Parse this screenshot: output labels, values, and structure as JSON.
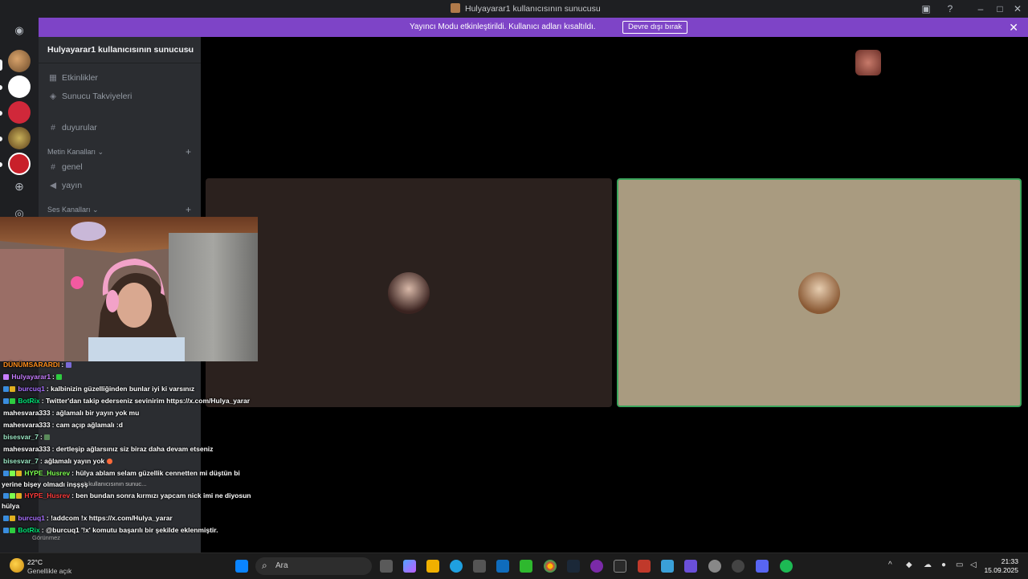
{
  "window": {
    "title": "Hulyayarar1 kullanıcısının sunucusu"
  },
  "banner": {
    "message": "Yayıncı Modu etkinleştirildi. Kullanıcı adları kısaltıldı.",
    "disable_button": "Devre dışı bırak"
  },
  "sidebar": {
    "server_name": "Hulyayarar1 kullanıcısının sunucusu",
    "items": [
      {
        "label": "Etkinlikler",
        "icon": "calendar-icon"
      },
      {
        "label": "Sunucu Takviyeleri",
        "icon": "boost-icon"
      },
      {
        "label": "duyurular",
        "icon": "hash-icon"
      }
    ],
    "text_category": "Metin Kanalları",
    "text_channels": [
      {
        "label": "genel",
        "icon": "hash-icon"
      },
      {
        "label": "yayın",
        "icon": "megaphone-icon"
      }
    ],
    "voice_category": "Ses Kanalları",
    "voice_hint": "1 kullanıcısının sunuc...",
    "status_hint": "Görünmez"
  },
  "chat": [
    {
      "user": "DÜNÜMSARARDI",
      "text": ":",
      "color": "#ff8c1a"
    },
    {
      "user": "Hulyayarar1",
      "text": ":",
      "color": "#c77dff"
    },
    {
      "user": "burcuq1",
      "text": ": kalbinizin güzelliğinden bunlar iyi ki varsınız",
      "color": "#a970ff"
    },
    {
      "user": "BotRix",
      "text": ": Twitter'dan takip ederseniz sevinirim https://x.com/Hulya_yarar",
      "color": "#00e676"
    },
    {
      "user": "mahesvara333",
      "text": ": ağlamalı bir yayın yok mu",
      "color": "#ffffff"
    },
    {
      "user": "mahesvara333",
      "text": ": cam açıp ağlamalı :d",
      "color": "#ffffff"
    },
    {
      "user": "bisesvar_7",
      "text": ":",
      "color": "#9be7c4"
    },
    {
      "user": "mahesvara333",
      "text": ": dertleşip ağlarsınız siz biraz daha devam etseniz",
      "color": "#ffffff"
    },
    {
      "user": "bisesvar_7",
      "text": ": ağlamalı yayın yok",
      "color": "#9be7c4"
    },
    {
      "user": "HYPE_Husrev",
      "text": ": hülya ablam selam güzellik cennetten mi düştün bi",
      "color": "#7cff4f"
    },
    {
      "user": "",
      "text": "yerine bişey olmadı inşşşş",
      "color": "#ffffff"
    },
    {
      "user": "HYPE_Husrev",
      "text": ": ben bundan sonra kırmızı yapcam nick imi ne diyosun",
      "color": "#ff3b3b"
    },
    {
      "user": "",
      "text": "hülya",
      "color": "#ffffff"
    },
    {
      "user": "burcuq1",
      "text": ": !addcom !x https://x.com/Hulya_yarar",
      "color": "#a970ff"
    },
    {
      "user": "BotRix",
      "text": ": @burcuq1 '!x' komutu başarılı bir şekilde eklenmiştir.",
      "color": "#00e676"
    }
  ],
  "taskbar": {
    "weather_temp": "22°C",
    "weather_desc": "Genellikle açık",
    "search_placeholder": "Ara",
    "time": "21:33",
    "date": "15.09.2025"
  },
  "colors": {
    "banner": "#7e44c7",
    "sidebar": "#2b2d31",
    "rail": "#1e1f22",
    "tile_left": "#2b211e",
    "tile_right": "#a99b80",
    "speaking_border": "#3ba55c"
  }
}
